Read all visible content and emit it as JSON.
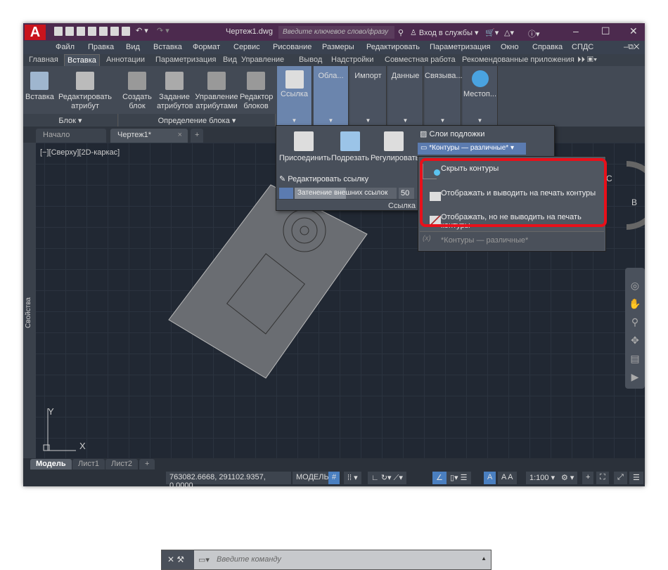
{
  "titlebar": {
    "doc_title": "Чертеж1.dwg",
    "search_placeholder": "Введите ключевое слово/фразу",
    "signin": "Вход в службы",
    "logo": "A"
  },
  "menu": [
    "Файл",
    "Правка",
    "Вид",
    "Вставка",
    "Формат",
    "Сервис",
    "Рисование",
    "Размеры",
    "Редактировать",
    "Параметризация",
    "Окно",
    "Справка",
    "СПДС"
  ],
  "ribbon_tabs": [
    "Главная",
    "Вставка",
    "Аннотации",
    "Параметризация",
    "Вид",
    "Управление",
    "Вывод",
    "Надстройки",
    "Совместная работа",
    "Рекомендованные приложения"
  ],
  "active_ribbon_tab": "Вставка",
  "ribbon": {
    "block_buttons": [
      "Вставка",
      "Редактировать атрибут"
    ],
    "block_panel": "Блок ▾",
    "def_buttons": [
      "Создать блок",
      "Задание атрибутов",
      "Управление атрибутами",
      "Редактор блоков"
    ],
    "def_panel": "Определение блока ▾",
    "collapsed": [
      "Ссылка",
      "Обла...",
      "Импорт",
      "Данные",
      "Связыва...",
      "Местоп..."
    ]
  },
  "doc_tabs": [
    "Начало",
    "Чертеж1*"
  ],
  "viewport_label": "[−][Сверху][2D-каркас]",
  "side_palette": "Свойства",
  "reference_panel": {
    "buttons": [
      "Присоединить",
      "Подрезать",
      "Регулировать"
    ],
    "underlay_layers": "Слои подложки",
    "frame_select": "*Контуры — различные*",
    "edit_ref": "Редактировать ссылку",
    "fade_label": "Затенение внешних ссылок",
    "fade_value": "50",
    "fade_percent": 50,
    "panel_title": "Ссылка"
  },
  "frame_options": [
    "Скрыть контуры",
    "Отображать и выводить на печать контуры",
    "Отображать, но не выводить на печать контуры"
  ],
  "frame_current": "*Контуры — различные*",
  "highlight_color": "#e8101a",
  "command_placeholder": "Введите команду",
  "layout_tabs": [
    "Модель",
    "Лист1",
    "Лист2"
  ],
  "status": {
    "coords": "763082.6668, 291102.9357, 0.0000",
    "mode": "МОДЕЛЬ",
    "scale": "1:100"
  },
  "ucs": {
    "x": "X",
    "y": "Y"
  },
  "viewcube": {
    "c": "С",
    "b": "В"
  }
}
